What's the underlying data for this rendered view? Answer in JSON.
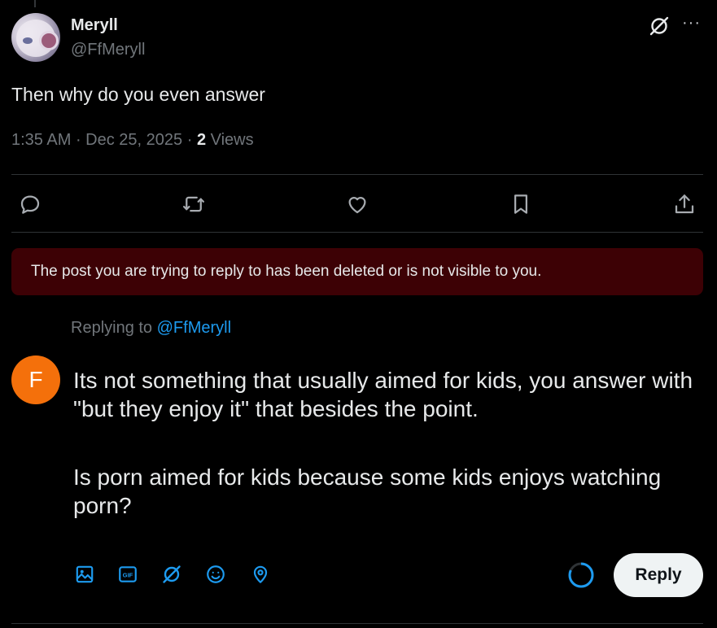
{
  "post": {
    "author_name": "Meryll",
    "author_handle": "@FfMeryll",
    "text": "Then why do you even answer",
    "time": "1:35 AM",
    "date": "Dec 25, 2025",
    "views_count": "2",
    "views_label": "Views",
    "more_label": "···"
  },
  "banner": {
    "text": "The post you are trying to reply to has been deleted or is not visible to you."
  },
  "reply": {
    "replying_to_label": "Replying to",
    "replying_to_handle": "@FfMeryll",
    "avatar_letter": "F",
    "paragraph_1": "Its not something that usually aimed for kids, you answer with \"but they enjoy it\" that besides the point.",
    "paragraph_2": "Is porn aimed for kids because some kids enjoys watching porn?",
    "button_label": "Reply"
  },
  "icons": {
    "actions": [
      "reply-icon",
      "repost-icon",
      "like-icon",
      "bookmark-icon",
      "share-icon"
    ],
    "composer": [
      "image-icon",
      "gif-icon",
      "grok-icon",
      "emoji-icon",
      "location-icon"
    ],
    "gif_text": "GIF"
  },
  "colors": {
    "accent": "#1d9bf0",
    "banner_bg": "#3d0105",
    "avatar_orange": "#f4700b",
    "muted": "#71767b"
  }
}
